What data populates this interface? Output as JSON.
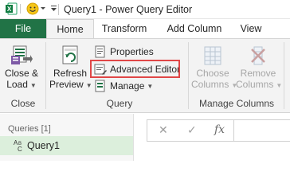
{
  "window": {
    "title": "Query1 - Power Query Editor"
  },
  "tabs": [
    {
      "label": "File"
    },
    {
      "label": "Home"
    },
    {
      "label": "Transform"
    },
    {
      "label": "Add Column"
    },
    {
      "label": "View"
    }
  ],
  "ribbon": {
    "close_load": {
      "line1": "Close &",
      "line2": "Load"
    },
    "refresh_preview": {
      "line1": "Refresh",
      "line2": "Preview"
    },
    "properties": "Properties",
    "advanced_editor": "Advanced Editor",
    "manage": "Manage",
    "choose_columns": {
      "line1": "Choose",
      "line2": "Columns"
    },
    "remove_columns": {
      "line1": "Remove",
      "line2": "Columns"
    },
    "groups": {
      "close": "Close",
      "query": "Query",
      "manage_columns": "Manage Columns"
    }
  },
  "queries_pane": {
    "header": "Queries [1]",
    "items": [
      {
        "type_icon": "ABC",
        "label": "Query1"
      }
    ]
  },
  "formula_bar": {
    "cancel": "✕",
    "commit": "✓",
    "fx": "fx"
  },
  "colors": {
    "file_tab": "#217346",
    "selected_query": "#dcefdc",
    "highlight_border": "#e04747"
  }
}
